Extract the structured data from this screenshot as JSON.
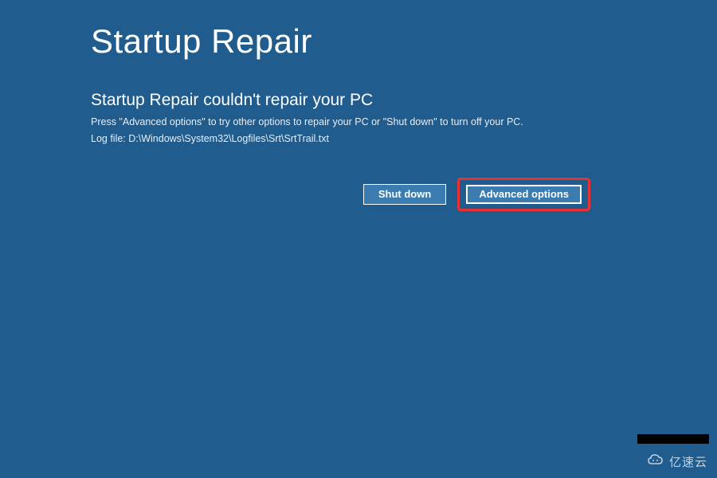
{
  "page": {
    "title": "Startup Repair",
    "subheading": "Startup Repair couldn't repair your PC",
    "description": "Press \"Advanced options\" to try other options to repair your PC or \"Shut down\" to turn off your PC.",
    "logfile": "Log file: D:\\Windows\\System32\\Logfiles\\Srt\\SrtTrail.txt"
  },
  "buttons": {
    "shutdown_label": "Shut down",
    "advanced_label": "Advanced options"
  },
  "watermark": {
    "text": "亿速云"
  },
  "colors": {
    "background": "#215c8e",
    "button_bg": "#3a7cb0",
    "highlight": "#e63232"
  }
}
